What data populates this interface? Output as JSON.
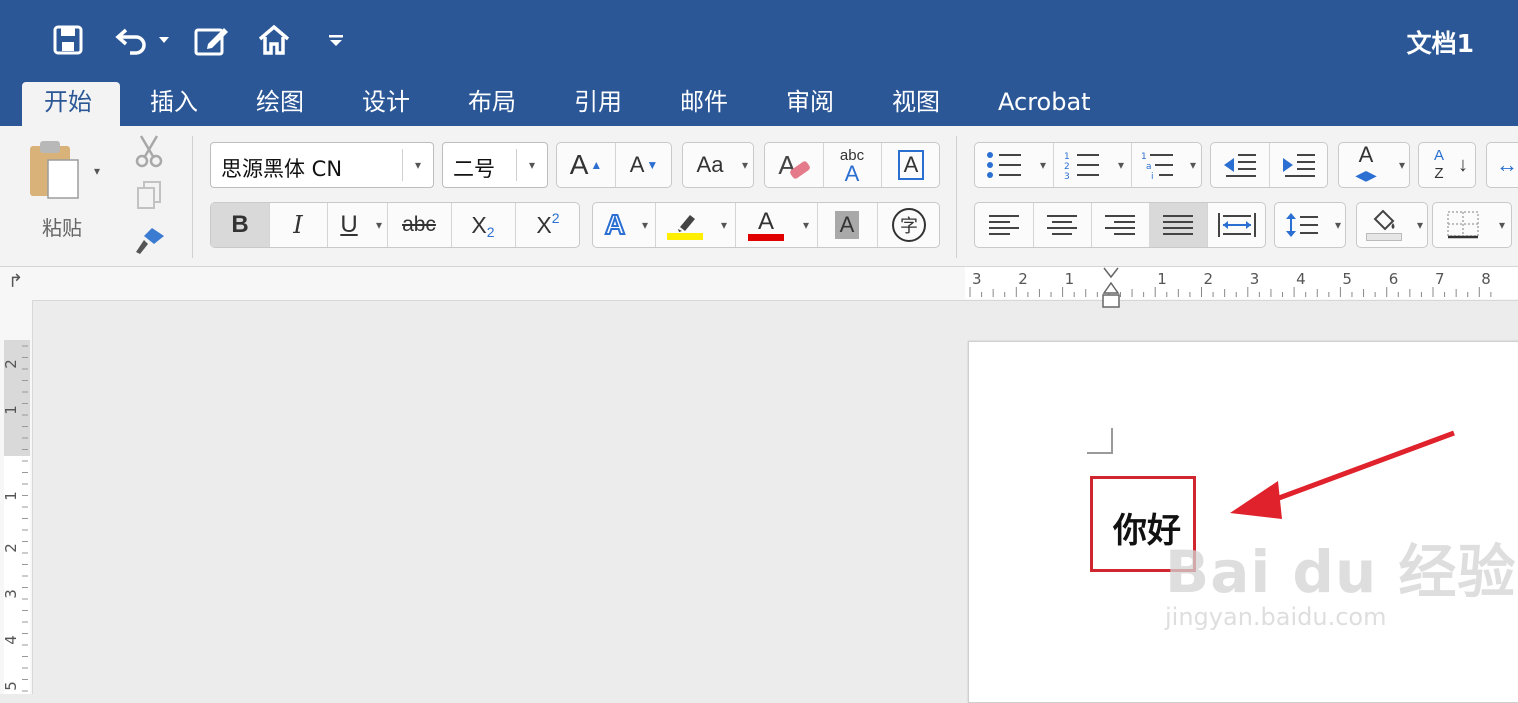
{
  "window": {
    "title": "文档1",
    "accent_color": "#2b5797"
  },
  "quick_access": [
    "save-icon",
    "undo-icon",
    "edit-icon",
    "home-icon",
    "customize-icon"
  ],
  "tabs": [
    {
      "label": "开始",
      "active": true
    },
    {
      "label": "插入"
    },
    {
      "label": "绘图"
    },
    {
      "label": "设计"
    },
    {
      "label": "布局"
    },
    {
      "label": "引用"
    },
    {
      "label": "邮件"
    },
    {
      "label": "审阅"
    },
    {
      "label": "视图"
    },
    {
      "label": "Acrobat"
    }
  ],
  "clipboard": {
    "paste_label": "粘贴"
  },
  "font": {
    "name": "思源黑体 CN",
    "size": "二号",
    "grow": "A",
    "shrink": "A",
    "change_case": "Aa",
    "clear_format": "A",
    "phonetic_top": "abc",
    "phonetic_bottom": "A",
    "border_char": "A",
    "bold": "B",
    "italic": "I",
    "underline": "U",
    "strike": "abc",
    "subscript": "X",
    "subscript_mark": "2",
    "superscript": "X",
    "superscript_mark": "2",
    "text_effects": "A",
    "font_color": "A",
    "char_shading": "A",
    "enclose": "字",
    "highlight_color": "#ffee00",
    "font_color_value": "#e00000"
  },
  "paragraph": {
    "sort_top": "A",
    "sort_bottom": "Z",
    "styles_letter": "A"
  },
  "ruler": {
    "h_labels": [
      "3",
      "2",
      "1",
      "1",
      "2",
      "3",
      "4",
      "5",
      "6",
      "7",
      "8"
    ],
    "v_labels": [
      "2",
      "1",
      "1",
      "2",
      "3",
      "4",
      "5"
    ]
  },
  "document": {
    "text": "你好"
  },
  "watermark": {
    "brand": "Bai du 经验",
    "url": "jingyan.baidu.com"
  }
}
